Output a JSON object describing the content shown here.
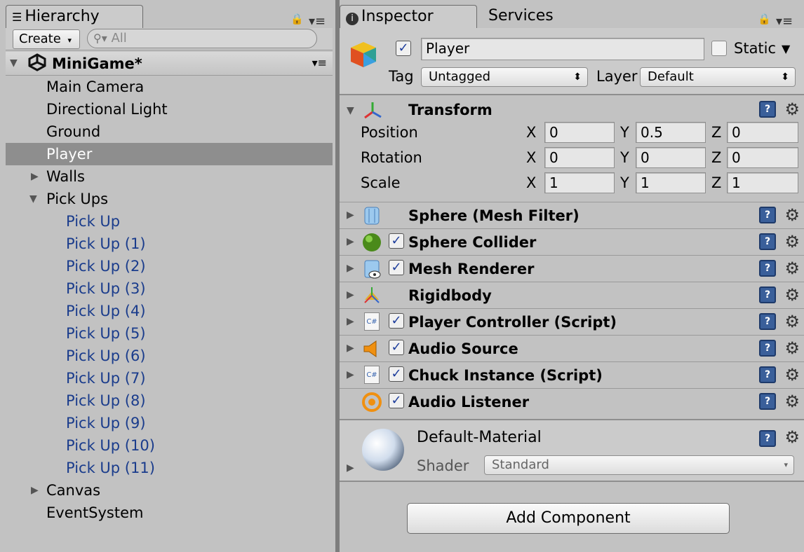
{
  "hierarchy": {
    "tab_title": "Hierarchy",
    "create_label": "Create",
    "search_placeholder": "All",
    "scene_name": "MiniGame*",
    "items": [
      {
        "label": "Main Camera"
      },
      {
        "label": "Directional Light"
      },
      {
        "label": "Ground"
      },
      {
        "label": "Player"
      },
      {
        "label": "Walls"
      },
      {
        "label": "Pick Ups"
      },
      {
        "label": "Pick Up"
      },
      {
        "label": "Pick Up (1)"
      },
      {
        "label": "Pick Up (2)"
      },
      {
        "label": "Pick Up (3)"
      },
      {
        "label": "Pick Up (4)"
      },
      {
        "label": "Pick Up (5)"
      },
      {
        "label": "Pick Up (6)"
      },
      {
        "label": "Pick Up (7)"
      },
      {
        "label": "Pick Up (8)"
      },
      {
        "label": "Pick Up (9)"
      },
      {
        "label": "Pick Up (10)"
      },
      {
        "label": "Pick Up (11)"
      },
      {
        "label": "Canvas"
      },
      {
        "label": "EventSystem"
      }
    ]
  },
  "inspector": {
    "tab_title": "Inspector",
    "tab2_title": "Services",
    "object_name": "Player",
    "static_label": "Static",
    "tag_label": "Tag",
    "tag_value": "Untagged",
    "layer_label": "Layer",
    "layer_value": "Default",
    "transform": {
      "title": "Transform",
      "position_label": "Position",
      "rotation_label": "Rotation",
      "scale_label": "Scale",
      "axis_x": "X",
      "axis_y": "Y",
      "axis_z": "Z",
      "position": [
        "0",
        "0.5",
        "0"
      ],
      "rotation": [
        "0",
        "0",
        "0"
      ],
      "scale": [
        "1",
        "1",
        "1"
      ]
    },
    "components": [
      {
        "label": "Sphere (Mesh Filter)"
      },
      {
        "label": "Sphere Collider"
      },
      {
        "label": "Mesh Renderer"
      },
      {
        "label": "Rigidbody"
      },
      {
        "label": "Player Controller (Script)"
      },
      {
        "label": "Audio Source"
      },
      {
        "label": "Chuck Instance (Script)"
      },
      {
        "label": "Audio Listener"
      }
    ],
    "material": {
      "name": "Default-Material",
      "shader_label": "Shader",
      "shader_value": "Standard"
    },
    "add_component_label": "Add Component",
    "help_glyph": "?",
    "cs_glyph": "C#"
  },
  "colors": {
    "selection": "#8e8e8e",
    "prefab_text": "#1a3c8c",
    "panel_bg": "#c2c2c2"
  }
}
